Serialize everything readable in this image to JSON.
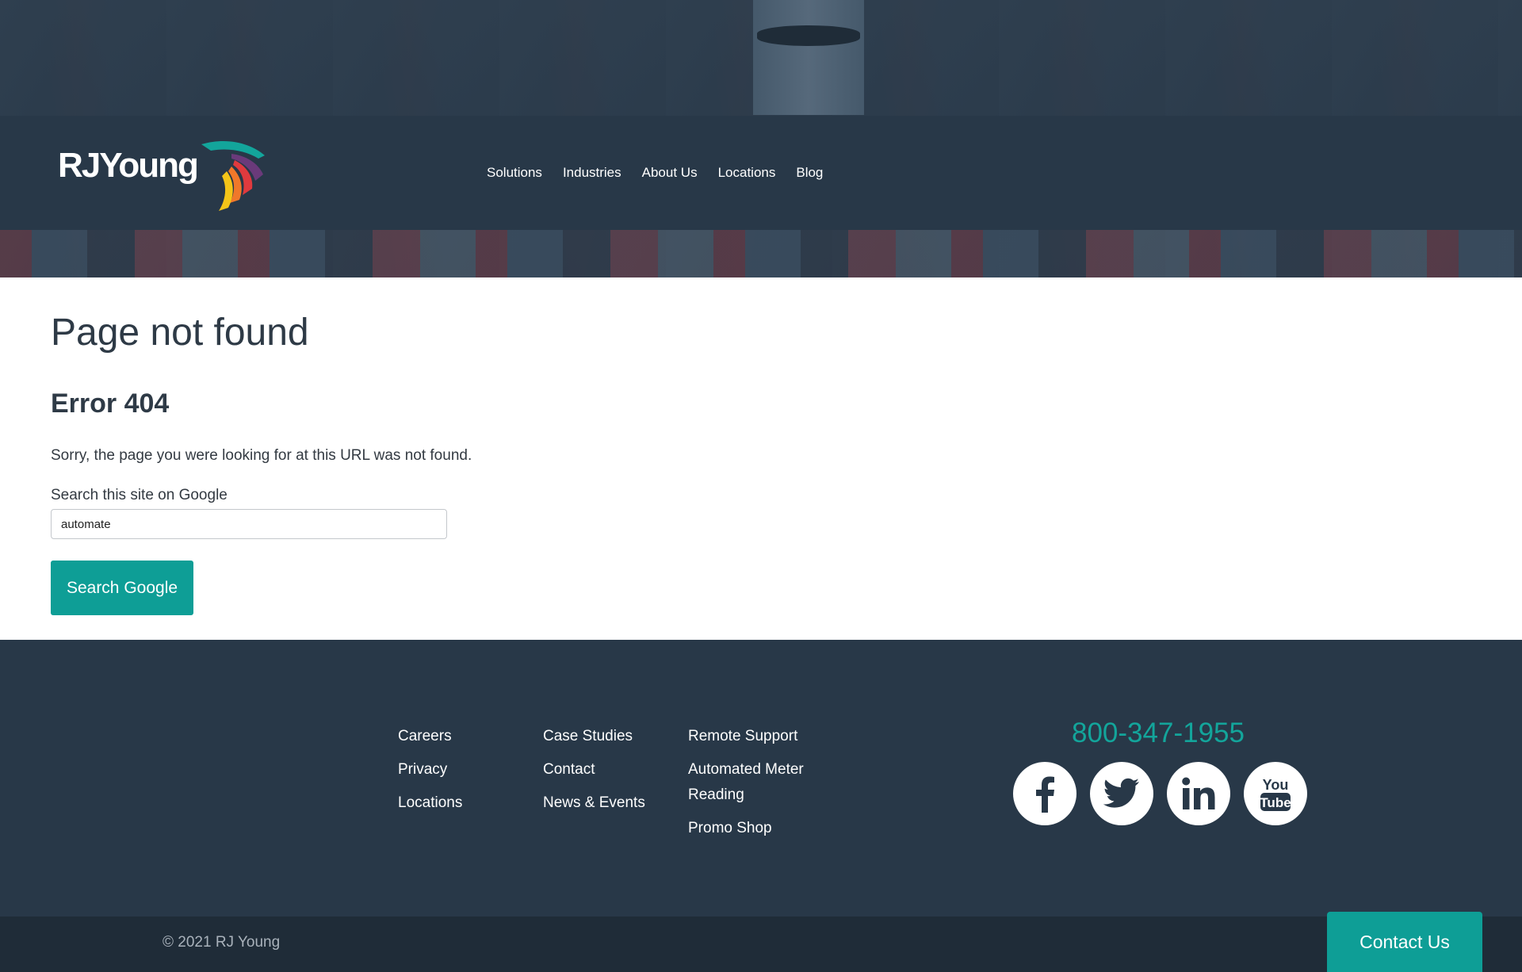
{
  "header": {
    "logo_text": "RJYoung",
    "nav": [
      "Solutions",
      "Industries",
      "About Us",
      "Locations",
      "Blog"
    ]
  },
  "main": {
    "title": "Page not found",
    "error_heading": "Error 404",
    "message": "Sorry, the page you were looking for at this URL was not found.",
    "search_label": "Search this site on Google",
    "search_value": "automate",
    "search_button": "Search Google"
  },
  "footer": {
    "col1": [
      "Careers",
      "Privacy",
      "Locations"
    ],
    "col2": [
      "Case Studies",
      "Contact",
      "News & Events"
    ],
    "col3": [
      "Remote Support",
      "Automated Meter Reading",
      "Promo Shop"
    ],
    "phone": "800-347-1955",
    "socials": [
      "facebook-icon",
      "twitter-icon",
      "linkedin-icon",
      "youtube-icon"
    ],
    "copyright": "© 2021 RJ Young",
    "contact_button": "Contact Us"
  },
  "colors": {
    "header_bg": "#283848",
    "accent_teal": "#0e9e96",
    "footer_bottom": "#1f2c38"
  }
}
